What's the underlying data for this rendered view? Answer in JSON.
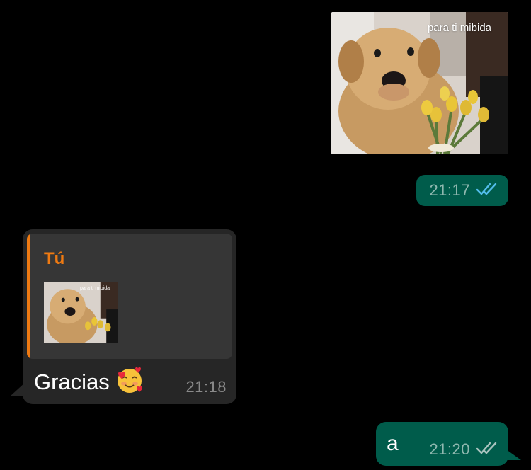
{
  "messages": {
    "sticker": {
      "caption": "para ti mibida",
      "time": "21:17",
      "ticks_color": "#53bdeb"
    },
    "reply": {
      "author": "Tú",
      "thumb_caption": "para ti mibida",
      "text": "Gracias",
      "emoji_name": "smiling-face-with-hearts",
      "time": "21:18"
    },
    "last": {
      "text": "a",
      "time": "21:20",
      "ticks_color": "#a9c3be"
    }
  },
  "colors": {
    "background": "#000000",
    "outgoing_bubble": "#005c4b",
    "incoming_bubble": "#262626",
    "quote_box": "#363636",
    "quote_accent": "#ef7a12"
  }
}
